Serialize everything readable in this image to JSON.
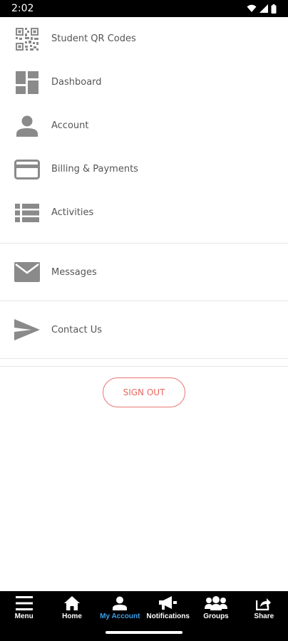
{
  "status_bar": {
    "time": "2:02"
  },
  "menu": {
    "items": [
      {
        "label": "Student QR Codes",
        "icon": "qr-code-icon"
      },
      {
        "label": "Dashboard",
        "icon": "dashboard-icon"
      },
      {
        "label": "Account",
        "icon": "person-icon"
      },
      {
        "label": "Billing & Payments",
        "icon": "credit-card-icon"
      },
      {
        "label": "Activities",
        "icon": "list-icon"
      },
      {
        "label": "Messages",
        "icon": "envelope-icon"
      },
      {
        "label": "Contact Us",
        "icon": "send-icon"
      }
    ]
  },
  "signout": {
    "label": "SIGN OUT"
  },
  "bottom_nav": {
    "items": [
      {
        "label": "Menu",
        "icon": "hamburger-icon"
      },
      {
        "label": "Home",
        "icon": "home-icon"
      },
      {
        "label": "My Account",
        "icon": "person-icon",
        "active": true
      },
      {
        "label": "Notifications",
        "icon": "megaphone-icon"
      },
      {
        "label": "Groups",
        "icon": "groups-icon"
      },
      {
        "label": "Share",
        "icon": "share-icon"
      }
    ]
  },
  "colors": {
    "icon_gray": "#8a8a8a",
    "signout_accent": "#e8675f",
    "active_nav": "#3aa0e8"
  }
}
